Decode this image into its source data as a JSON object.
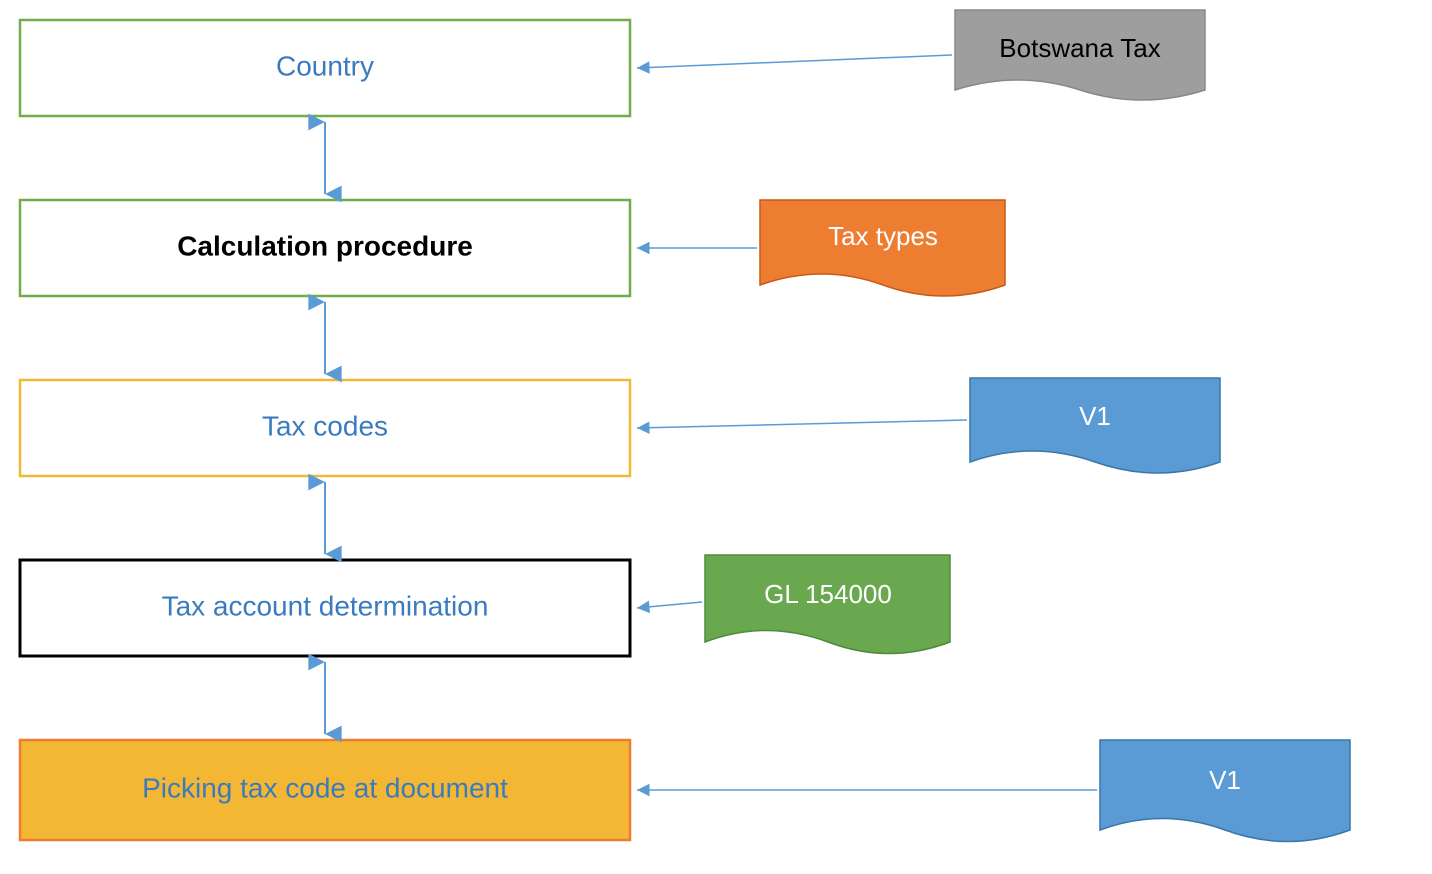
{
  "colors": {
    "blue_text": "#3a7bbf",
    "black_text": "#000000",
    "white_text": "#ffffff",
    "green_border": "#6aa84f",
    "box_green_border": "#70ad47",
    "box_yellow_border": "#f2b733",
    "box_black_border": "#000000",
    "box_orange_border": "#ed7d31",
    "fill_white": "#ffffff",
    "fill_grey": "#9e9e9e",
    "fill_orange": "#ed7d31",
    "fill_blue": "#5b9bd5",
    "fill_green": "#6aa84f",
    "fill_gold": "#f4b733",
    "arrow_blue": "#5b9bd5"
  },
  "boxes": {
    "country": {
      "label": "Country"
    },
    "calc": {
      "label": "Calculation procedure"
    },
    "codes": {
      "label": "Tax codes"
    },
    "acct": {
      "label": "Tax account determination"
    },
    "picking": {
      "label": "Picking tax code at document"
    }
  },
  "docs": {
    "botswana": {
      "label": "Botswana Tax"
    },
    "taxtypes": {
      "label": "Tax types"
    },
    "v1a": {
      "label": "V1"
    },
    "gl": {
      "label": "GL  154000"
    },
    "v1b": {
      "label": "V1"
    }
  }
}
